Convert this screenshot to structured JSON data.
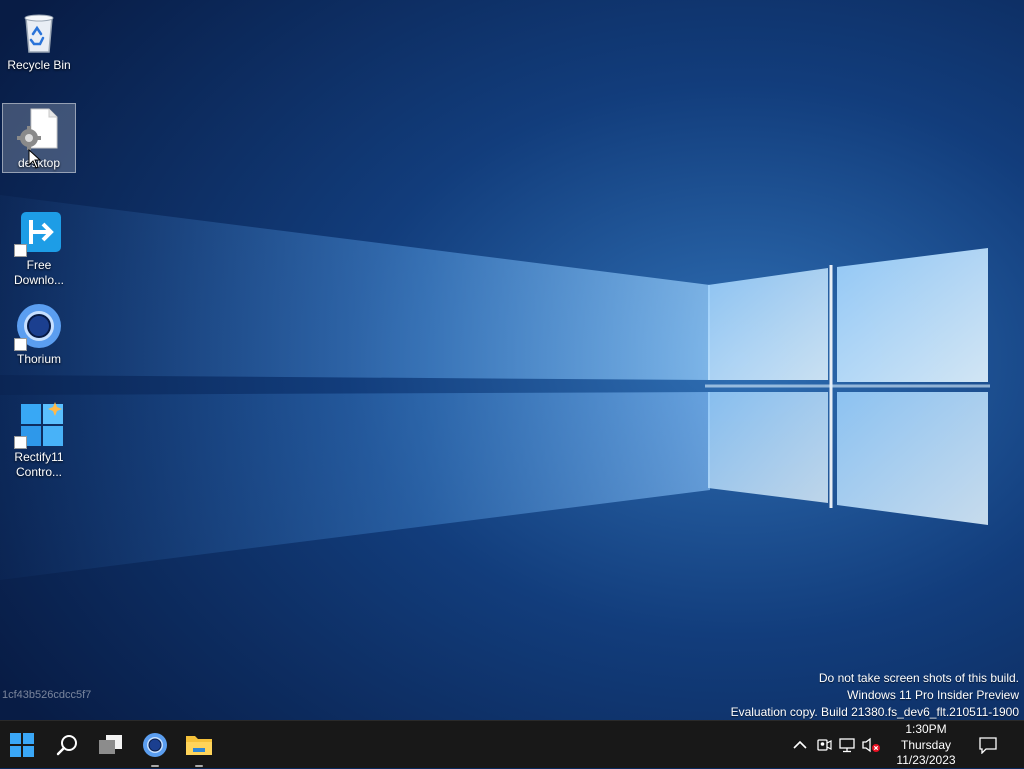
{
  "desktop": {
    "icons": [
      {
        "label": "Recycle Bin"
      },
      {
        "label": "desktop"
      },
      {
        "label": "Free\nDownlo..."
      },
      {
        "label": "Thorium"
      },
      {
        "label": "Rectify11\nContro..."
      }
    ],
    "machine_id": "1cf43b526cdcc5f7",
    "watermark": {
      "line1": "Do not take screen shots of this build.",
      "line2": "Windows 11 Pro Insider Preview",
      "line3": "Evaluation copy. Build 21380.fs_dev6_flt.210511-1900"
    }
  },
  "taskbar": {
    "buttons": [
      "start-icon",
      "search-icon",
      "task-view-icon",
      "thorium-browser-icon",
      "file-explorer-icon"
    ],
    "tray_icons": [
      "chevron-up-icon",
      "meet-now-icon",
      "network-disconnected-icon",
      "volume-muted-icon",
      "notification-icon"
    ],
    "clock": {
      "time": "1:30PM",
      "day": "Thursday",
      "date": "11/23/2023"
    }
  },
  "colors": {
    "taskbar_bg": "#181818",
    "wallpaper_dark": "#0b2a5c",
    "wallpaper_light": "#5fb6ff"
  }
}
